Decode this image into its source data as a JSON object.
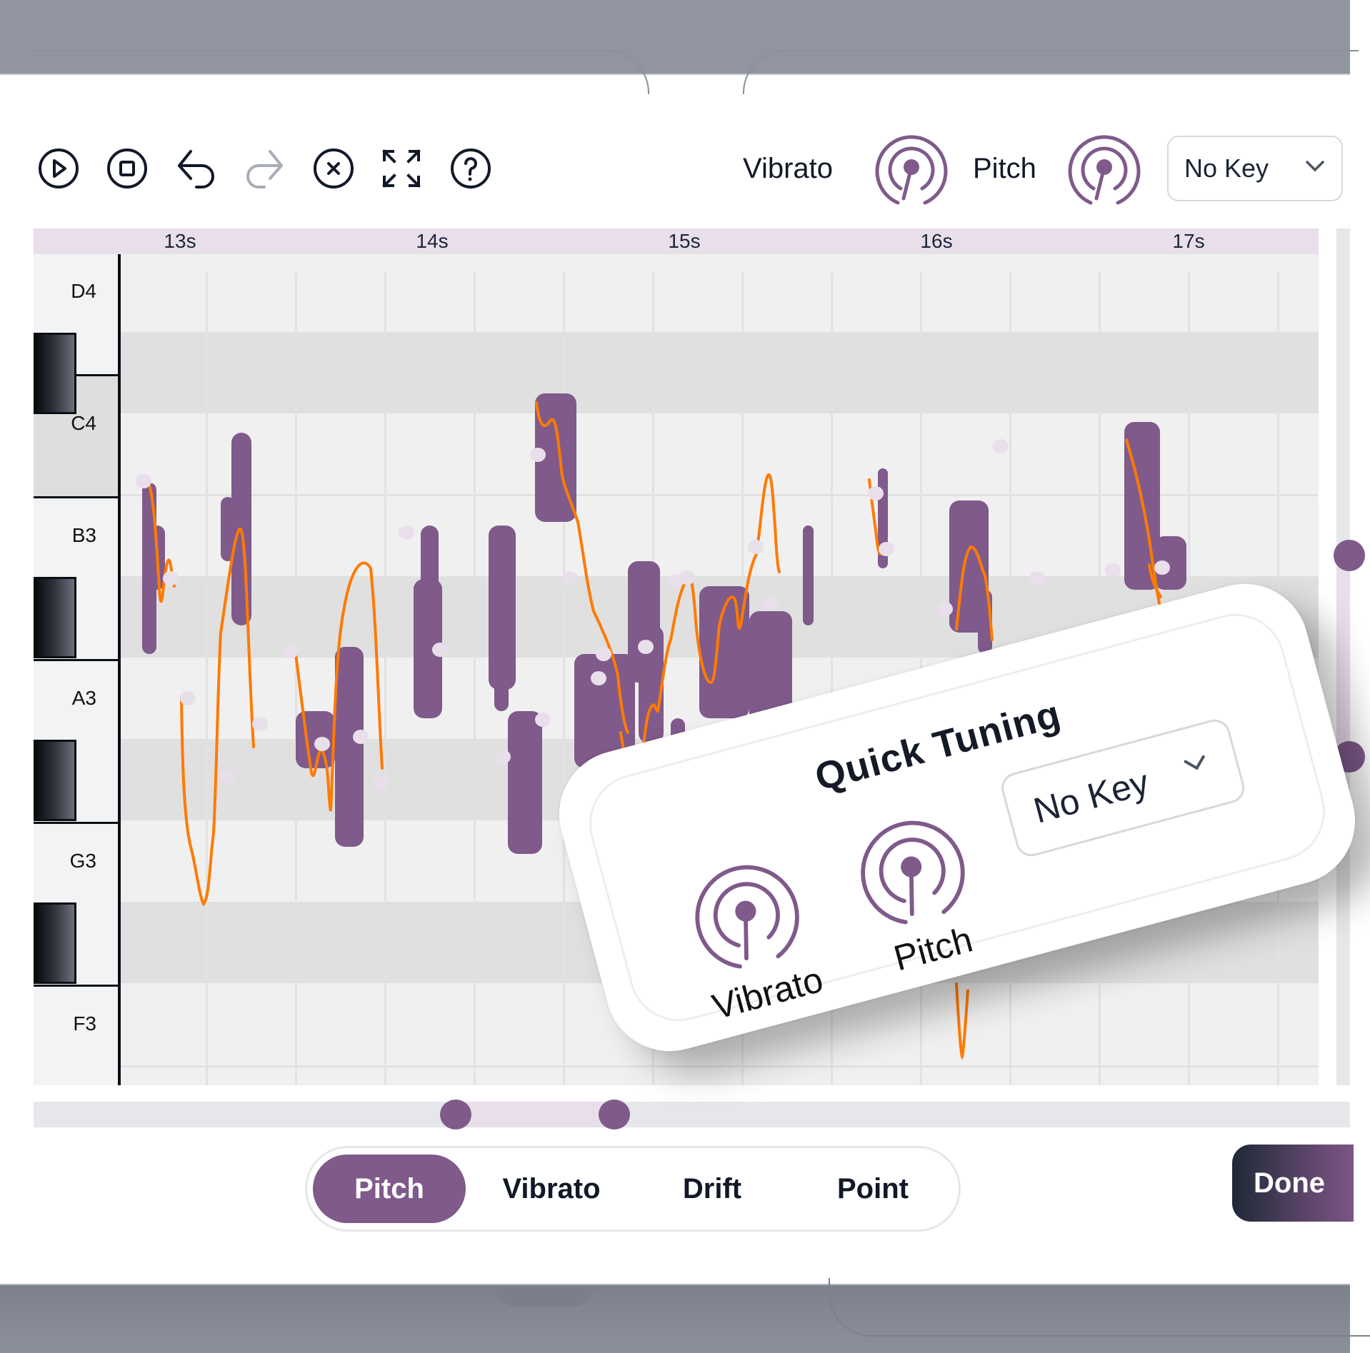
{
  "toolbar": {
    "buttons": [
      {
        "name": "play",
        "icon": "play-circle-icon",
        "enabled": true
      },
      {
        "name": "stop",
        "icon": "stop-circle-icon",
        "enabled": true
      },
      {
        "name": "undo",
        "icon": "undo-icon",
        "enabled": true
      },
      {
        "name": "redo",
        "icon": "redo-icon",
        "enabled": false
      },
      {
        "name": "clear",
        "icon": "close-circle-icon",
        "enabled": true
      },
      {
        "name": "fullscreen",
        "icon": "expand-icon",
        "enabled": true
      },
      {
        "name": "help",
        "icon": "help-circle-icon",
        "enabled": true
      }
    ],
    "vibrato_label": "Vibrato",
    "pitch_label": "Pitch",
    "key_select": {
      "value": "No Key"
    }
  },
  "timeline": {
    "ticks": [
      "13s",
      "14s",
      "15s",
      "16s",
      "17s"
    ]
  },
  "piano": {
    "labels": [
      "D4",
      "C4",
      "B3",
      "A3",
      "G3",
      "F3"
    ],
    "highlighted_key": "C4"
  },
  "modes": {
    "tabs": [
      {
        "label": "Pitch",
        "active": true
      },
      {
        "label": "Vibrato",
        "active": false
      },
      {
        "label": "Drift",
        "active": false
      },
      {
        "label": "Point",
        "active": false
      }
    ]
  },
  "done_label": "Done",
  "quick_tuning": {
    "title": "Quick Tuning",
    "vibrato_label": "Vibrato",
    "pitch_label": "Pitch",
    "key_select": {
      "value": "No Key"
    }
  },
  "colors": {
    "accent": "#7f5a8b",
    "accent_light": "#e8dfea",
    "pitch_curve": "#ff7a00",
    "node": "#e8dfea",
    "text": "#111827"
  },
  "scroll": {
    "horizontal_visible_range": [
      0.32,
      0.44
    ],
    "vertical_visible_range": [
      0.38,
      0.62
    ]
  }
}
